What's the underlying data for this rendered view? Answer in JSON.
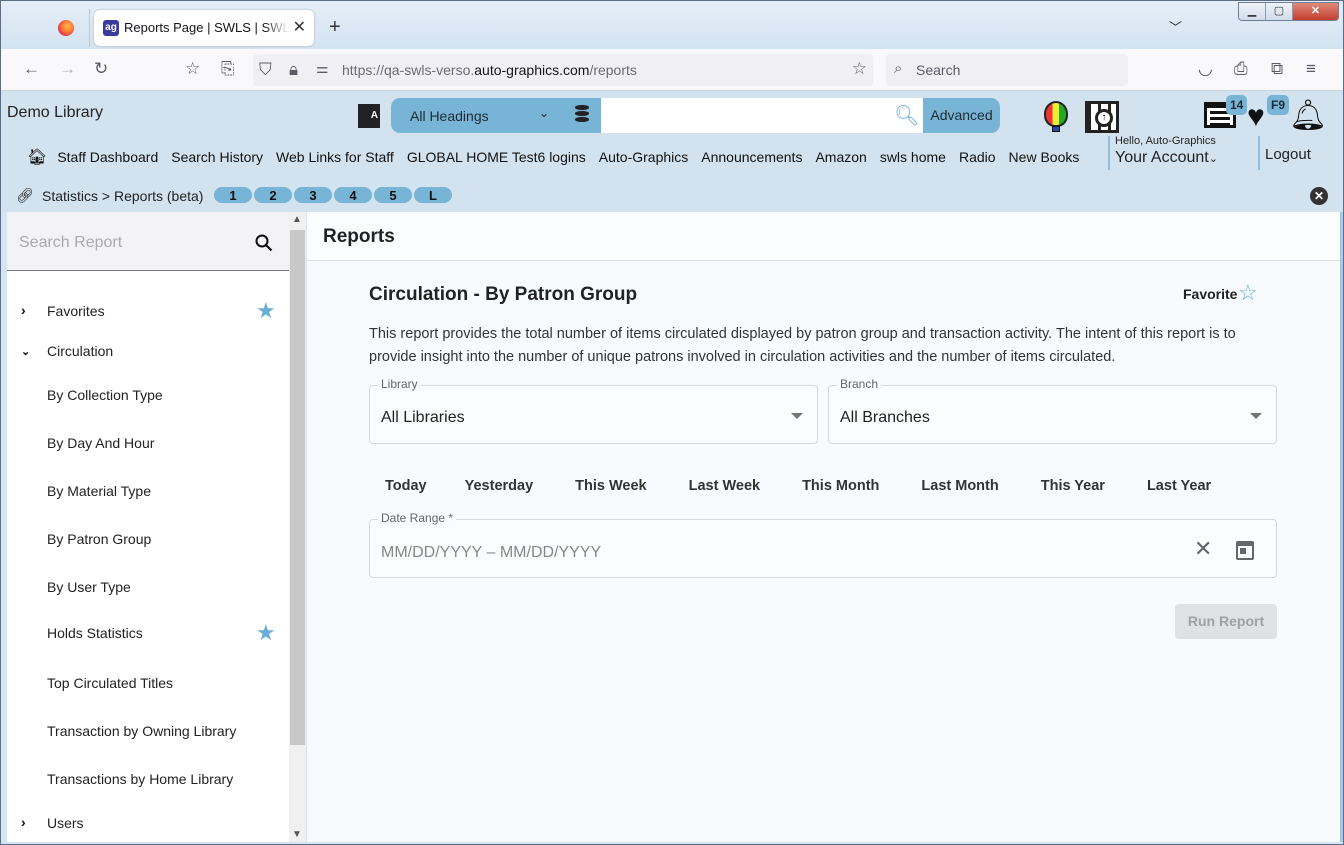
{
  "browser": {
    "tab_title": "Reports Page | SWLS | SWLS | Auto-Graphics",
    "tab_favicon": "ag-logo-icon",
    "url_prefix": "https://qa-swls-verso.",
    "url_domain": "auto-graphics.com",
    "url_path": "/reports",
    "search_placeholder": "Search",
    "window_controls": {
      "minimize": "minimize-icon",
      "maximize": "maximize-icon",
      "close": "close-icon"
    }
  },
  "header": {
    "library_name": "Demo Library",
    "search_scope": "All Headings",
    "search_value": "",
    "advanced_label": "Advanced",
    "badges": {
      "list": "14",
      "favorites": "F9"
    },
    "greeting": "Hello, Auto-Graphics",
    "account_label": "Your Account",
    "logout_label": "Logout",
    "links": [
      "Staff Dashboard",
      "Search History",
      "Web Links for Staff",
      "GLOBAL HOME Test6 logins",
      "Auto-Graphics",
      "Announcements",
      "Amazon",
      "swls home",
      "Radio",
      "New Books"
    ]
  },
  "breadcrumb": {
    "path": "Statistics > Reports (beta)",
    "pills": [
      "1",
      "2",
      "3",
      "4",
      "5",
      "L"
    ]
  },
  "sidebar": {
    "search_placeholder": "Search Report",
    "items": [
      {
        "label": "Favorites",
        "type": "group",
        "expanded": false,
        "starred": true
      },
      {
        "label": "Circulation",
        "type": "group",
        "expanded": true,
        "starred": false
      },
      {
        "label": "By Collection Type",
        "type": "report",
        "starred": false
      },
      {
        "label": "By Day And Hour",
        "type": "report",
        "starred": false
      },
      {
        "label": "By Material Type",
        "type": "report",
        "starred": false
      },
      {
        "label": "By Patron Group",
        "type": "report",
        "starred": false
      },
      {
        "label": "By User Type",
        "type": "report",
        "starred": false
      },
      {
        "label": "Holds Statistics",
        "type": "report",
        "starred": true
      },
      {
        "label": "Top Circulated Titles",
        "type": "report",
        "starred": false
      },
      {
        "label": "Transaction by Owning Library",
        "type": "report",
        "starred": false
      },
      {
        "label": "Transactions by Home Library",
        "type": "report",
        "starred": false
      },
      {
        "label": "Users",
        "type": "group",
        "expanded": false,
        "starred": false
      }
    ]
  },
  "main": {
    "page_title": "Reports",
    "report_title": "Circulation - By Patron Group",
    "favorite_label": "Favorite",
    "description": "This report provides the total number of items circulated displayed by patron group and transaction activity. The intent of this report is to provide insight into the number of unique patrons involved in circulation activities and the number of items circulated.",
    "library_label": "Library",
    "library_value": "All Libraries",
    "branch_label": "Branch",
    "branch_value": "All Branches",
    "quick_ranges": [
      "Today",
      "Yesterday",
      "This Week",
      "Last Week",
      "This Month",
      "Last Month",
      "This Year",
      "Last Year"
    ],
    "date_range_label": "Date Range *",
    "date_range_placeholder": "MM/DD/YYYY – MM/DD/YYYY",
    "run_label": "Run Report"
  },
  "colors": {
    "accent": "#78b4d6",
    "header_bg": "#d2e3ef",
    "star": "#6aaed6"
  }
}
